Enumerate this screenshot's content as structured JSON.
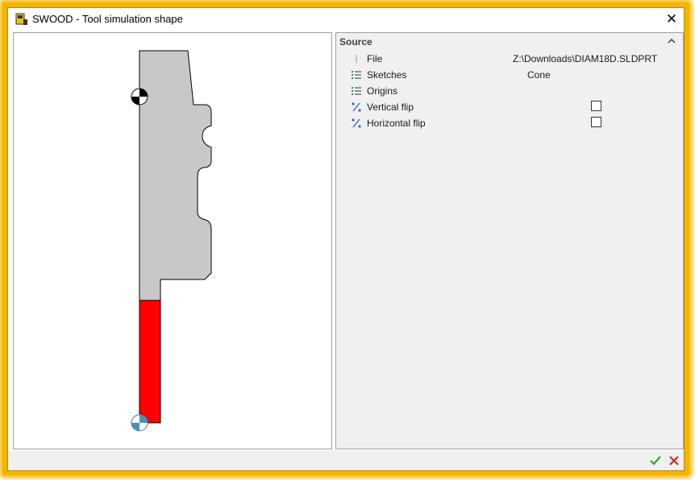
{
  "window": {
    "title": "SWOOD - Tool simulation shape"
  },
  "colors": {
    "border_glow": "#f4b400",
    "shape_fill": "#c8c8c8",
    "cutting_part": "#ff0000",
    "confirm": "#3a9e2e",
    "cancel": "#d9271c"
  },
  "properties": {
    "section_title": "Source",
    "rows": [
      {
        "label": "File",
        "value": "Z:\\Downloads\\DIAM18D.SLDPRT",
        "icon": "file-icon"
      },
      {
        "label": "Sketches",
        "value": "Cone",
        "icon": "list-icon"
      },
      {
        "label": "Origins",
        "value": "",
        "icon": "list-icon"
      },
      {
        "label": "Vertical flip",
        "checked": false,
        "icon": "flip-icon"
      },
      {
        "label": "Horizontal flip",
        "checked": false,
        "icon": "flip-icon"
      }
    ]
  }
}
